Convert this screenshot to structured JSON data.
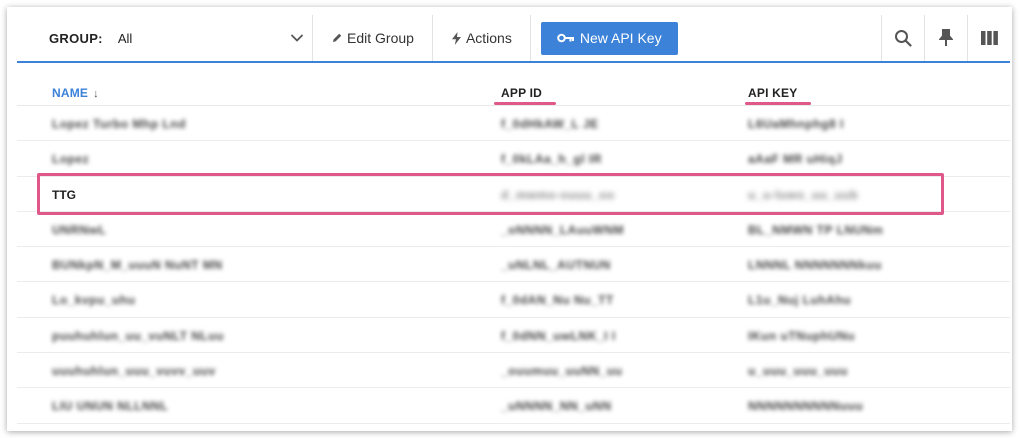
{
  "toolbar": {
    "group_label": "GROUP:",
    "group_value": "All",
    "edit_group_label": "Edit Group",
    "actions_label": "Actions",
    "new_api_key_label": "New API Key",
    "accent_color": "#3b82d8"
  },
  "table": {
    "columns": {
      "name": "NAME",
      "app_id": "APP ID",
      "api_key": "API KEY"
    },
    "sort_indicator": "↓",
    "rows": [
      {
        "name": "Lopez Turbo Mhp Lnd",
        "app_id": "f_0dHkAW_L JE",
        "api_key": "L6UaMhnphg8 I"
      },
      {
        "name": "Lopez",
        "app_id": "f_0kLAa_h_gl IR",
        "api_key": "aAaF MR uHiqJ"
      },
      {
        "name": "TTG",
        "app_id": "d_mwmo-ouuu_oo",
        "api_key": "u_u-luwo_uu_uub"
      },
      {
        "name": "UNRNwL",
        "app_id": "_oNNNN_LAuuWNM",
        "api_key": "BL_NMWN TP LNUNm"
      },
      {
        "name": "BUNkpN_M_uuuN NuNT MN",
        "app_id": "_uNLNL_AUTNUN",
        "api_key": "LNNNL NNNNNNNkuu"
      },
      {
        "name": "Lo_kvpu_uhu",
        "app_id": "f_0dAN_Nu Nu_TT",
        "api_key": "L1u_Nuj LuhAhu"
      },
      {
        "name": "puuhuhlun_uu_vuNLT NLuu",
        "app_id": "f_0dNN_uwLNK_I I",
        "api_key": "IKun uTNuphUNu"
      },
      {
        "name": "uuuhuhlun_uuu_vuvv_uuv",
        "app_id": "_ouumuu_uuNN_uu",
        "api_key": "u_uuu_uuu_uuu"
      },
      {
        "name": "LIU UNUN NLLNNL",
        "app_id": "_uNNNN_NN_uNN",
        "api_key": "NNNNNNNNNNuuu"
      }
    ]
  },
  "highlight_color": "#e0578a"
}
